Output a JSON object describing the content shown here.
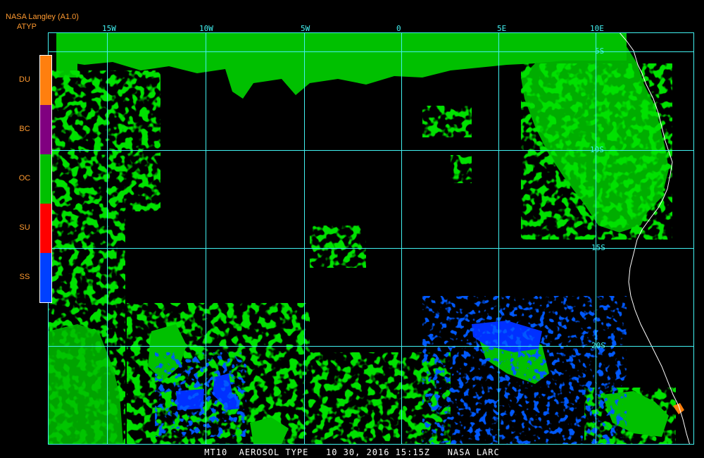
{
  "header": {
    "org": "NASA Langley (A1.0)",
    "product": "ATYP"
  },
  "legend": {
    "items": [
      {
        "code": "DU",
        "color": "#ff7f0e"
      },
      {
        "code": "BC",
        "color": "#800080"
      },
      {
        "code": "OC",
        "color": "#00c000"
      },
      {
        "code": "SU",
        "color": "#ff0000"
      },
      {
        "code": "SS",
        "color": "#0040ff"
      }
    ]
  },
  "grid": {
    "longitudes": [
      "15W",
      "10W",
      "5W",
      "0",
      "5E",
      "10E"
    ],
    "latitudes": [
      "5S",
      "10S",
      "15S",
      "20S"
    ],
    "line_color": "#41f0f0"
  },
  "footer": {
    "text": "MT10  AEROSOL TYPE   10 30, 2016 15:15Z   NASA LARC"
  },
  "colors": {
    "background": "#000000",
    "coast": "#ffffff"
  }
}
